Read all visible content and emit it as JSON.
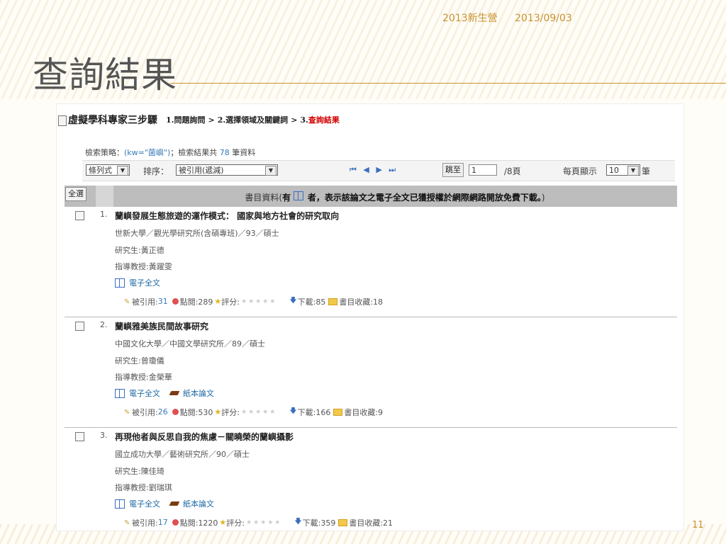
{
  "slide": {
    "header_left": "2013新生營",
    "header_right": "2013/09/03",
    "title": "查詢結果",
    "page_number": "11"
  },
  "steps": {
    "brand": "虛擬學科專家三步驟",
    "step1": "1.問題詢問",
    "sep1": ">",
    "step2": "2.選擇領域及關鍵詞",
    "sep2": ">",
    "step3_prefix": "3.",
    "step3": "查詢結果"
  },
  "strategy": {
    "label": "檢索策略：",
    "keyword": "(kw=\"菌嶼\")",
    "middle": "；檢索結果共",
    "count": "78",
    "suffix": "筆資料"
  },
  "toolbar": {
    "view_mode": "條列式",
    "sort_label": "排序：",
    "sort_value": "被引用(遞減)",
    "pager_icons": "⏮ ◀ ▶ ⏭",
    "jump_label": "跳至",
    "jump_value": "1",
    "total_pages": "/8頁",
    "per_page_label": "每頁顯示",
    "per_page_value": "10",
    "per_page_suffix": "筆"
  },
  "list_header": {
    "select_all": "全選",
    "text_prefix": "書目資料(",
    "text_bold": "有",
    "text_bold2": "者，表示該論文之電子全文已獲授權於網際網路開放免費下載。",
    "text_suffix": ")"
  },
  "records": [
    {
      "num": "1.",
      "title": "蘭嶼發展生態旅遊的運作模式： 國家與地方社會的研究取向",
      "school": "世新大學／觀光學研究所(含碩專班)／93／碩士",
      "student": "研究生:黃正德",
      "advisor": "指導教授:黃躍雯",
      "ebook": "電子全文",
      "paper": "",
      "cited_label": "被引用:",
      "cited": "31",
      "views": "點閱:289",
      "rating": "評分:",
      "downloads": "下載:85",
      "bookmarks": "書目收藏:18"
    },
    {
      "num": "2.",
      "title": "蘭嶼雅美族民間故事研究",
      "school": "中國文化大學／中國文學研究所／89／碩士",
      "student": "研究生:曾瓊儀",
      "advisor": "指導教授:金榮華",
      "ebook": "電子全文",
      "paper": "紙本論文",
      "cited_label": "被引用:",
      "cited": "26",
      "views": "點閱:530",
      "rating": "評分:",
      "downloads": "下載:166",
      "bookmarks": "書目收藏:9"
    },
    {
      "num": "3.",
      "title": "再現他者與反思自我的焦慮－關曉榮的蘭嶼攝影",
      "school": "國立成功大學／藝術研究所／90／碩士",
      "student": "研究生:陳佳琦",
      "advisor": "指導教授:劉瑞琪",
      "ebook": "電子全文",
      "paper": "紙本論文",
      "cited_label": "被引用:",
      "cited": "17",
      "views": "點閱:1220",
      "rating": "評分:",
      "downloads": "下載:359",
      "bookmarks": "書目收藏:21"
    }
  ]
}
